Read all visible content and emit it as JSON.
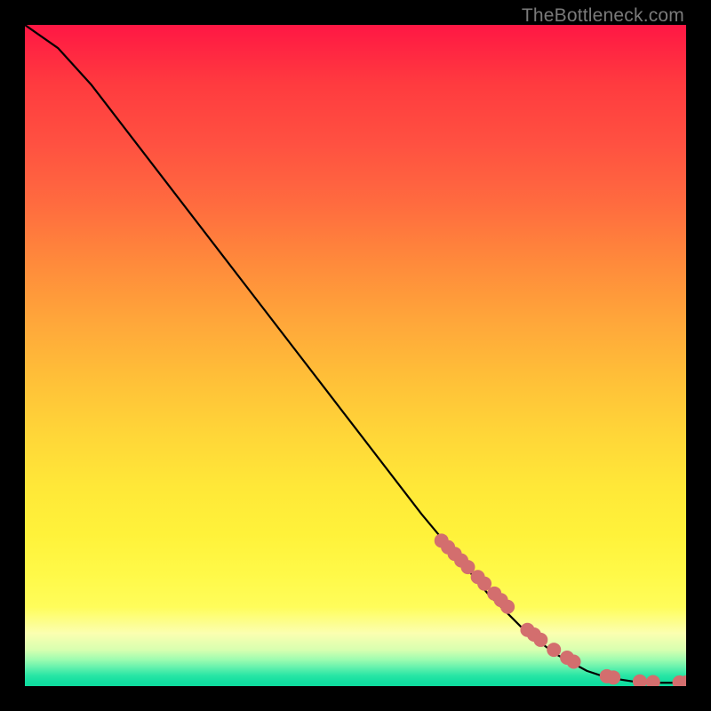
{
  "watermark": "TheBottleneck.com",
  "colors": {
    "line": "#000000",
    "marker_fill": "#d36e6e",
    "marker_stroke": "#b75c5c",
    "frame_bg": "#000000"
  },
  "chart_data": {
    "type": "line",
    "title": "",
    "xlabel": "",
    "ylabel": "",
    "xlim": [
      0,
      100
    ],
    "ylim": [
      0,
      100
    ],
    "grid": false,
    "legend": false,
    "series": [
      {
        "name": "curve",
        "x": [
          0,
          5,
          10,
          15,
          20,
          25,
          30,
          35,
          40,
          45,
          50,
          55,
          60,
          65,
          70,
          75,
          80,
          85,
          88,
          92,
          95,
          98,
          100
        ],
        "y": [
          100,
          96.5,
          91,
          84.5,
          78,
          71.5,
          65,
          58.5,
          52,
          45.5,
          39,
          32.5,
          26,
          20,
          14,
          9,
          5,
          2.3,
          1.3,
          0.7,
          0.5,
          0.5,
          0.5
        ]
      }
    ],
    "scatter_points": {
      "name": "highlighted-points",
      "x": [
        63,
        64,
        65,
        66,
        67,
        68.5,
        69.5,
        71,
        72,
        73,
        76,
        77,
        78,
        80,
        82,
        83,
        88,
        89,
        93,
        95,
        99,
        100
      ],
      "y": [
        22,
        21,
        20,
        19,
        18,
        16.5,
        15.5,
        14,
        13,
        12,
        8.5,
        7.8,
        7,
        5.5,
        4.3,
        3.7,
        1.5,
        1.3,
        0.7,
        0.6,
        0.55,
        0.55
      ],
      "marker_radius": 8
    }
  }
}
